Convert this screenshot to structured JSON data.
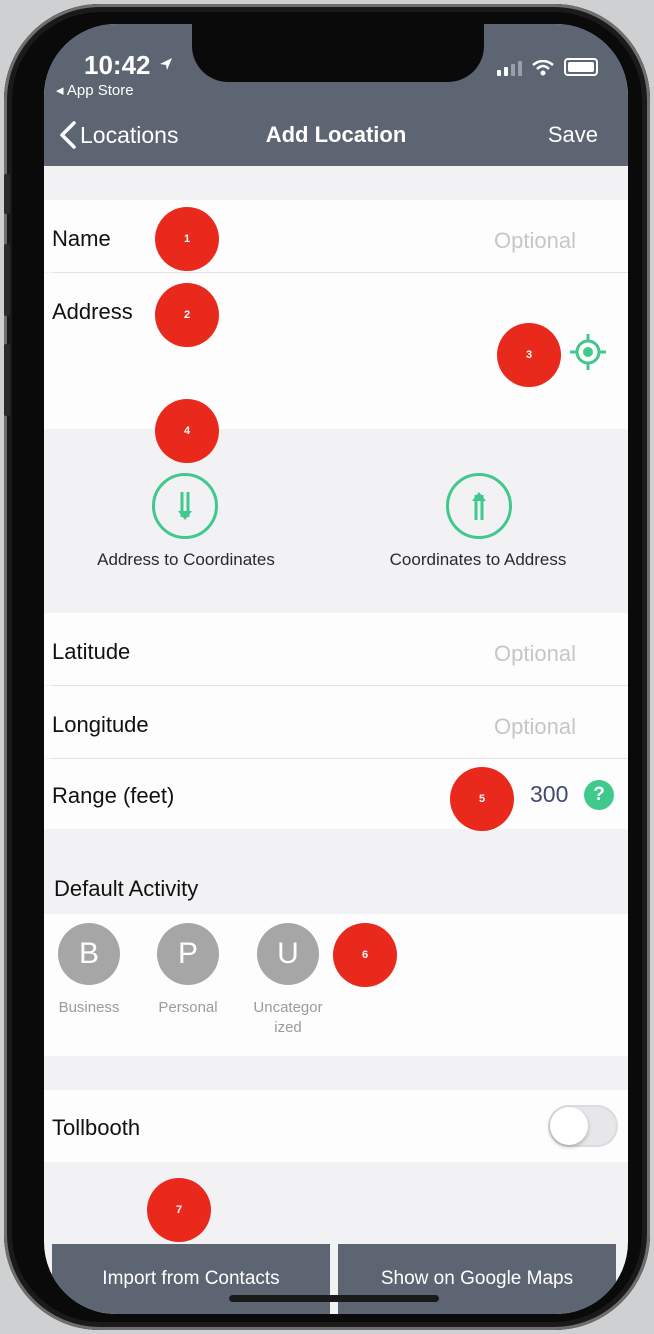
{
  "status_bar": {
    "time": "10:42",
    "back_app": "◂ App Store"
  },
  "nav": {
    "back_label": "Locations",
    "title": "Add Location",
    "save_label": "Save"
  },
  "form": {
    "name_label": "Name",
    "name_placeholder": "Optional",
    "address_label": "Address",
    "latitude_label": "Latitude",
    "latitude_placeholder": "Optional",
    "longitude_label": "Longitude",
    "longitude_placeholder": "Optional",
    "range_label": "Range (feet)",
    "range_value": "300",
    "help_symbol": "?"
  },
  "conversions": {
    "address_to_coords": "Address to Coordinates",
    "coords_to_address": "Coordinates to Address"
  },
  "default_activity": {
    "header": "Default Activity",
    "options": [
      {
        "letter": "B",
        "label": "Business"
      },
      {
        "letter": "P",
        "label": "Personal"
      },
      {
        "letter": "U",
        "label": "Uncategor ized"
      }
    ]
  },
  "tollbooth": {
    "label": "Tollbooth",
    "enabled": false
  },
  "bottom_buttons": {
    "import": "Import from Contacts",
    "maps": "Show on Google Maps"
  },
  "badges": [
    "1",
    "2",
    "3",
    "4",
    "5",
    "6",
    "7"
  ],
  "colors": {
    "nav_bg": "#5d6573",
    "accent_green": "#3fc98d",
    "badge_red": "#e8291c",
    "range_value": "#3e4a73"
  },
  "icons": {
    "back": "chevron-left-icon",
    "locate": "crosshair-icon",
    "down": "arrows-down-icon",
    "up": "arrows-up-icon",
    "help": "question-circle-icon"
  }
}
